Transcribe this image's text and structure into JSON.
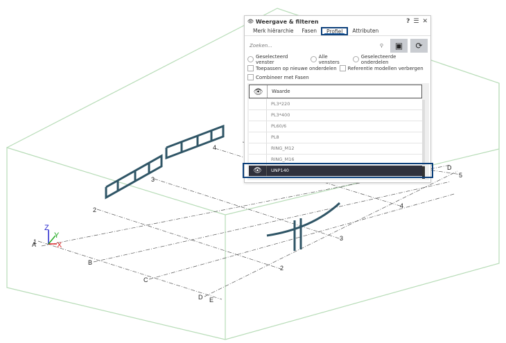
{
  "panel": {
    "title": "Weergave & filteren",
    "tabs": [
      {
        "label": "Merk hiërarchie"
      },
      {
        "label": "Fasen"
      },
      {
        "label": "Profiel",
        "active": true
      },
      {
        "label": "Attributen"
      }
    ],
    "search_placeholder": "Zoeken...",
    "radio_options": [
      "Geselecteerd venster",
      "Alle vensters",
      "Geselecteerde onderdelen"
    ],
    "checkboxes": [
      "Toepassen op nieuwe onderdelen",
      "Referentie modellen verbergen",
      "Combineer met Fasen"
    ],
    "column_header": "Waarde",
    "rows": [
      {
        "value": "PL3*220"
      },
      {
        "value": "PL3*400"
      },
      {
        "value": "PL60/6"
      },
      {
        "value": "PL8"
      },
      {
        "value": "RING_M12"
      },
      {
        "value": "RING_M16"
      },
      {
        "value": "UNP140",
        "selected": true,
        "visible": true
      }
    ]
  },
  "scene": {
    "grid_columns": [
      "1",
      "2",
      "3",
      "4",
      "5"
    ],
    "grid_rows": [
      "A",
      "B",
      "C",
      "D",
      "E"
    ],
    "axes": [
      "X",
      "Y",
      "Z"
    ],
    "colors": {
      "box": "#a8d8a8",
      "member": "#2f5566",
      "selection": "#0b3f7a",
      "row_selected": "#2f303b"
    }
  }
}
